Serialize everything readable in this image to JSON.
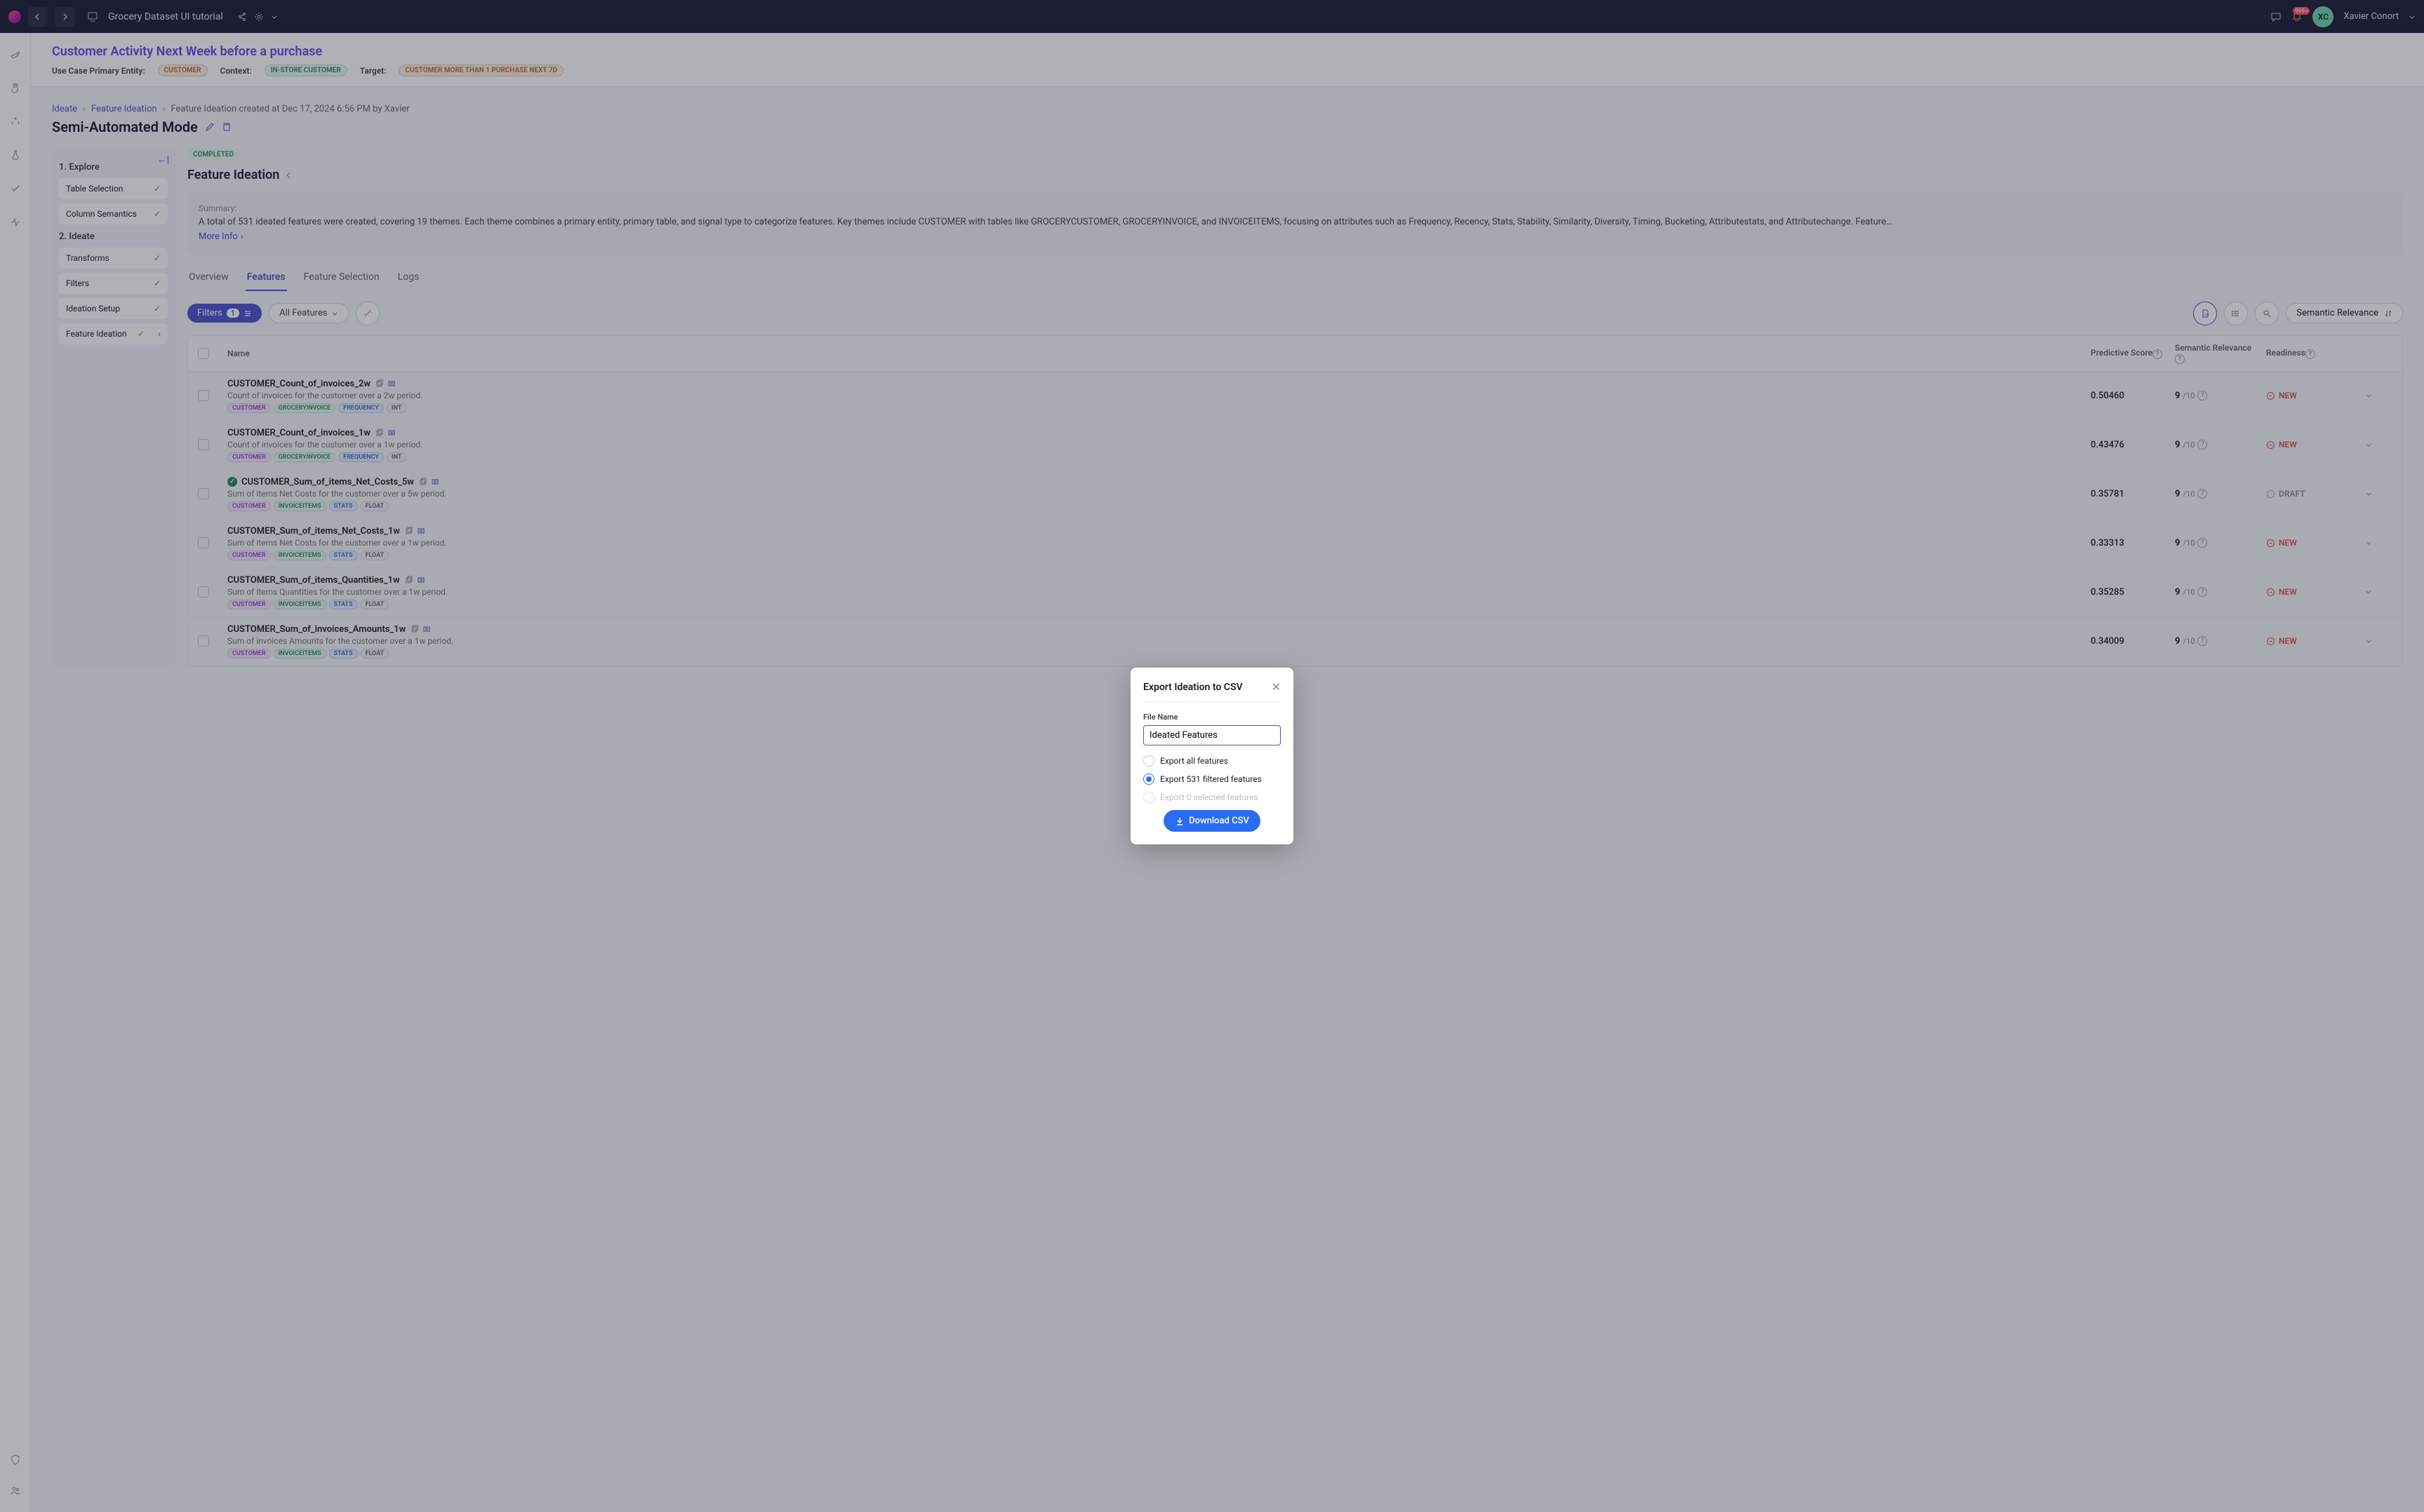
{
  "topbar": {
    "project": "Grocery Dataset UI tutorial",
    "user_initials": "XC",
    "user_name": "Xavier Conort",
    "notif_badge": "999+"
  },
  "header": {
    "title": "Customer Activity Next Week before a purchase",
    "entity_label": "Use Case Primary Entity:",
    "entity_chip": "CUSTOMER",
    "context_label": "Context:",
    "context_chip": "IN-STORE CUSTOMER",
    "target_label": "Target:",
    "target_chip": "CUSTOMER MORE THAN 1 PURCHASE NEXT 7D"
  },
  "crumbs": [
    "Ideate",
    "Feature Ideation",
    "Feature Ideation created at Dec 17, 2024 6:56 PM by Xavier"
  ],
  "mode_title": "Semi-Automated Mode",
  "sidebar": {
    "step1": "1. Explore",
    "step1_items": [
      "Table Selection",
      "Column Semantics"
    ],
    "step2": "2. Ideate",
    "step2_items": [
      "Transforms",
      "Filters",
      "Ideation Setup",
      "Feature Ideation"
    ]
  },
  "main": {
    "status": "COMPLETED",
    "title": "Feature Ideation",
    "summary_label": "Summary:",
    "summary_text": "A total of 531 ideated features were created, covering 19 themes. Each theme combines a primary entity, primary table, and signal type to categorize features. Key themes include CUSTOMER with tables like GROCERYCUSTOMER, GROCERYINVOICE, and INVOICEITEMS, focusing on attributes such as Frequency, Recency, Stats, Stability, Similarity, Diversity, Timing, Bucketing, Attributestats, and Attributechange. Feature…",
    "more_info": "More Info"
  },
  "tabs": [
    "Overview",
    "Features",
    "Feature Selection",
    "Logs"
  ],
  "filter": {
    "label": "Filters",
    "count": "1",
    "all": "All Features",
    "sort": "Semantic Relevance"
  },
  "columns": {
    "name": "Name",
    "pscore": "Predictive Score",
    "rel": "Semantic Relevance",
    "ready": "Readiness"
  },
  "rows": [
    {
      "name": "CUSTOMER_Count_of_invoices_2w",
      "desc": "Count of invoices for the customer over a 2w period.",
      "tags": [
        "CUSTOMER",
        "GROCERYINVOICE",
        "FREQUENCY",
        "INT"
      ],
      "score": "0.50460",
      "rel": "9",
      "rel_d": "/10",
      "ready": "NEW",
      "ready_kind": "new",
      "has_green": false
    },
    {
      "name": "CUSTOMER_Count_of_invoices_1w",
      "desc": "Count of invoices for the customer over a 1w period.",
      "tags": [
        "CUSTOMER",
        "GROCERYINVOICE",
        "FREQUENCY",
        "INT"
      ],
      "score": "0.43476",
      "rel": "9",
      "rel_d": "/10",
      "ready": "NEW",
      "ready_kind": "new",
      "has_green": false
    },
    {
      "name": "CUSTOMER_Sum_of_items_Net_Costs_5w",
      "desc": "Sum of items Net Costs for the customer over a 5w period.",
      "tags": [
        "CUSTOMER",
        "INVOICEITEMS",
        "STATS",
        "FLOAT"
      ],
      "score": "0.35781",
      "rel": "9",
      "rel_d": "/10",
      "ready": "DRAFT",
      "ready_kind": "draft",
      "has_green": true
    },
    {
      "name": "CUSTOMER_Sum_of_items_Net_Costs_1w",
      "desc": "Sum of items Net Costs for the customer over a 1w period.",
      "tags": [
        "CUSTOMER",
        "INVOICEITEMS",
        "STATS",
        "FLOAT"
      ],
      "score": "0.33313",
      "rel": "9",
      "rel_d": "/10",
      "ready": "NEW",
      "ready_kind": "new",
      "has_green": false
    },
    {
      "name": "CUSTOMER_Sum_of_items_Quantities_1w",
      "desc": "Sum of items Quantities for the customer over a 1w period.",
      "tags": [
        "CUSTOMER",
        "INVOICEITEMS",
        "STATS",
        "FLOAT"
      ],
      "score": "0.35285",
      "rel": "9",
      "rel_d": "/10",
      "ready": "NEW",
      "ready_kind": "new",
      "has_green": false
    },
    {
      "name": "CUSTOMER_Sum_of_invoices_Amounts_1w",
      "desc": "Sum of invoices Amounts for the customer over a 1w period.",
      "tags": [
        "CUSTOMER",
        "INVOICEITEMS",
        "STATS",
        "FLOAT"
      ],
      "score": "0.34009",
      "rel": "9",
      "rel_d": "/10",
      "ready": "NEW",
      "ready_kind": "new",
      "has_green": false
    }
  ],
  "modal": {
    "title": "Export Ideation to CSV",
    "file_label": "File Name",
    "file_value": "Ideated Features",
    "opt_all": "Export all features",
    "opt_filtered": "Export 531 filtered features",
    "opt_selected": "Export 0 selected features",
    "button": "Download CSV"
  }
}
